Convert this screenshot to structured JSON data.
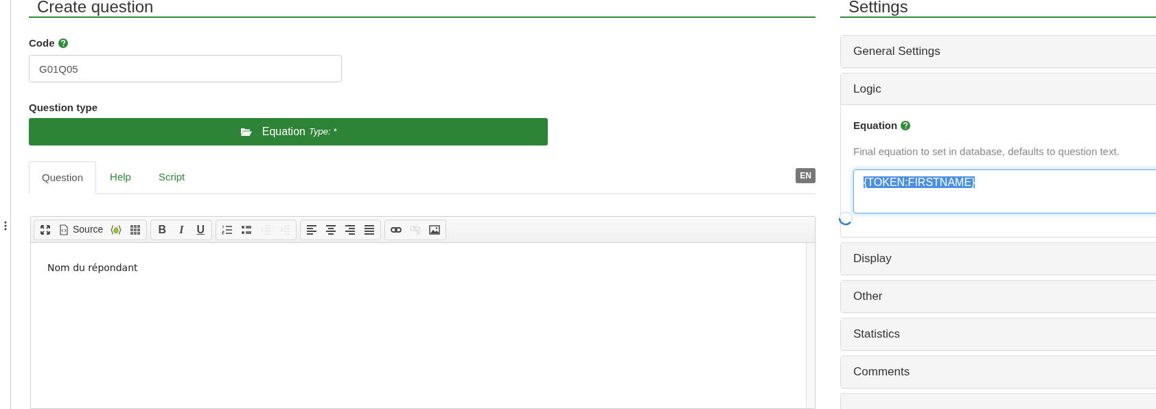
{
  "question": {
    "title": "Create question",
    "code": {
      "label": "Code",
      "value": "G01Q05"
    },
    "question_type": {
      "label": "Question type",
      "button_label": "Equation",
      "type_note": "Type: *"
    },
    "tabs": [
      {
        "label": "Question",
        "selected": true
      },
      {
        "label": "Help",
        "selected": false
      },
      {
        "label": "Script",
        "selected": false
      }
    ],
    "language_badge": "EN",
    "toolbar": [
      [
        {
          "kind": "maximize",
          "disabled": false
        },
        {
          "kind": "source",
          "label": "Source",
          "disabled": false
        },
        {
          "kind": "expression",
          "disabled": false
        },
        {
          "kind": "grid",
          "disabled": false
        }
      ],
      [
        {
          "kind": "bold",
          "label": "B",
          "disabled": false
        },
        {
          "kind": "italic",
          "label": "I",
          "disabled": false
        },
        {
          "kind": "underline",
          "label": "U",
          "disabled": false
        }
      ],
      [
        {
          "kind": "numbered",
          "disabled": false
        },
        {
          "kind": "bulleted",
          "disabled": false
        },
        {
          "kind": "outdent",
          "disabled": true
        },
        {
          "kind": "indent",
          "disabled": true
        }
      ],
      [
        {
          "kind": "left",
          "disabled": false
        },
        {
          "kind": "center",
          "disabled": false
        },
        {
          "kind": "right",
          "disabled": false
        },
        {
          "kind": "justify",
          "disabled": false
        }
      ],
      [
        {
          "kind": "link",
          "disabled": false
        },
        {
          "kind": "unlink",
          "disabled": true
        },
        {
          "kind": "image",
          "disabled": false
        }
      ]
    ],
    "editor_text": "Nom du répondant"
  },
  "settings": {
    "title": "Settings",
    "panels": [
      {
        "title": "General Settings",
        "expanded": false
      },
      {
        "title": "Logic",
        "expanded": true,
        "field": {
          "label": "Equation",
          "help": "Final equation to set in database, defaults to question text.",
          "value": "{TOKEN:FIRSTNAME}",
          "text_selected": true
        }
      },
      {
        "title": "Display",
        "expanded": false
      },
      {
        "title": "Other",
        "expanded": false
      },
      {
        "title": "Statistics",
        "expanded": false
      },
      {
        "title": "Comments",
        "expanded": false
      }
    ]
  }
}
